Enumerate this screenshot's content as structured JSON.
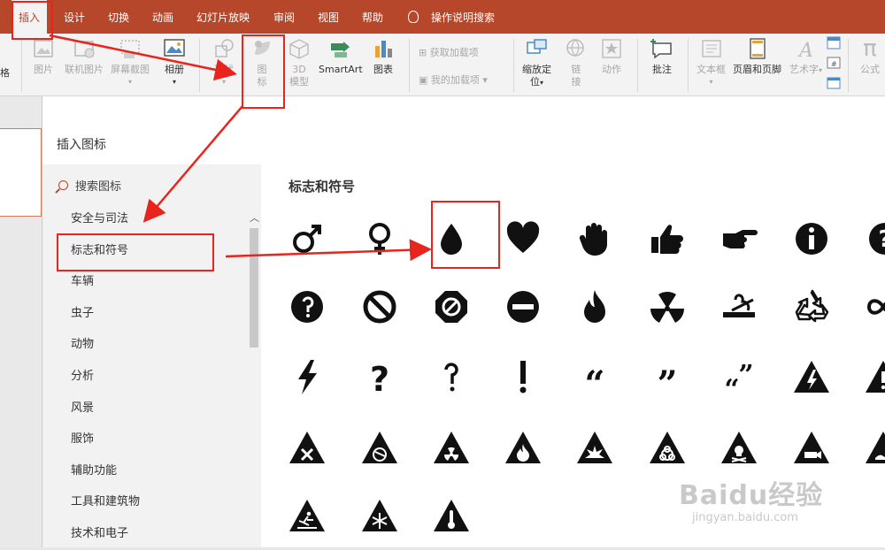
{
  "ribbon": {
    "tabs": [
      "插入",
      "设计",
      "切换",
      "动画",
      "幻灯片放映",
      "审阅",
      "视图",
      "帮助"
    ],
    "tell_me": "操作说明搜索",
    "buttons": {
      "picture": "图片",
      "online_picture": "联机图片",
      "screenshot": "屏幕截图",
      "album": "相册",
      "shapes": "形状",
      "icons_line1": "图",
      "icons_line2": "标",
      "model_line1": "3D",
      "model_line2": "模型",
      "smartart": "SmartArt",
      "chart": "图表",
      "get_addins": "获取加载项",
      "my_addins": "我的加载项",
      "zoom_line1": "缩放定",
      "zoom_line2": "位",
      "link_line1": "链",
      "link_line2": "接",
      "action": "动作",
      "comment": "批注",
      "textbox": "文本框",
      "header_footer": "页眉和页脚",
      "wordart": "艺术字",
      "equation": "公式",
      "left_clip1": "格",
      "left_clip2": "格"
    }
  },
  "dialog": {
    "title": "插入图标",
    "search_placeholder": "搜索图标",
    "categories": [
      "安全与司法",
      "标志和符号",
      "车辆",
      "虫子",
      "动物",
      "分析",
      "风景",
      "服饰",
      "辅助功能",
      "工具和建筑物",
      "技术和电子"
    ],
    "selected_category": "标志和符号",
    "section_title": "标志和符号",
    "icons": [
      "male-symbol",
      "female-symbol",
      "water-drop",
      "heart",
      "stop-hand",
      "thumbs-up",
      "pointing-hand",
      "info",
      "question-circle",
      "question-dark-circle",
      "no-entry-circle",
      "no-entry-octagon",
      "minus-circle",
      "flame",
      "radiation",
      "no-smoking",
      "recycle",
      "infinity",
      "lightning",
      "question-mark",
      "question-hook",
      "exclamation-mark",
      "quote-open",
      "quote-close",
      "quote-pair",
      "electric-warning",
      "exclamation-warning",
      "x-warning",
      "no-smoking-warning",
      "radiation-warning",
      "flammable-warning",
      "explosive-warning",
      "biohazard-warning",
      "toxic-warning",
      "camera-warning",
      "water-warning",
      "slippery-warning",
      "cold-warning",
      "temperature-warning"
    ]
  },
  "watermark": {
    "main": "Baidu经验",
    "sub": "jingyan.baidu.com"
  },
  "colors": {
    "accent": "#b7472a",
    "annotation": "#e8241c"
  }
}
